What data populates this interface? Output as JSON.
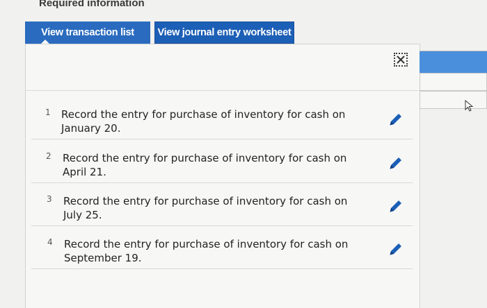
{
  "header": {
    "title": "Required information"
  },
  "tabs": [
    {
      "label": "View transaction list",
      "active": true
    },
    {
      "label": "View journal entry worksheet",
      "active": false
    }
  ],
  "transactions": [
    {
      "number": "1",
      "text": "Record the entry for purchase of inventory for cash on January 20.",
      "icon": "pencil-icon"
    },
    {
      "number": "2",
      "text": "Record the entry for purchase of inventory for cash on April 21.",
      "icon": "pencil-icon"
    },
    {
      "number": "3",
      "text": "Record the entry for purchase of inventory for cash on July 25.",
      "icon": "pencil-icon"
    },
    {
      "number": "4",
      "text": "Record the entry for purchase of inventory for cash on September 19.",
      "icon": "pencil-icon"
    }
  ],
  "icons": {
    "close": "close-icon",
    "edit": "pencil-icon",
    "cursor": "mouse-cursor-icon"
  },
  "colors": {
    "tab_active": "#2a6bbf",
    "tab_inactive": "#1c5fb6",
    "pencil": "#1b5fb6",
    "side_header": "#4a8fdc"
  }
}
